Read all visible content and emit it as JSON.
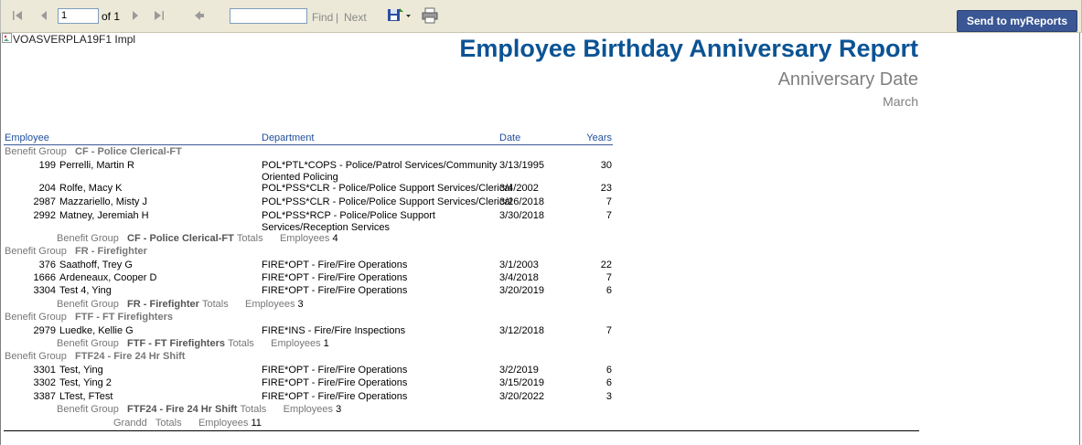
{
  "toolbar": {
    "page_value": "1",
    "of_label": "of 1",
    "find_label": "Find",
    "separator": "|",
    "next_label": "Next",
    "send_button": "Send to myReports"
  },
  "report": {
    "image_alt": "VOASVERPLA19F1 Impl",
    "title": "Employee Birthday Anniversary Report",
    "subtitle": "Anniversary Date",
    "month": "March",
    "columns": {
      "employee": "Employee",
      "department": "Department",
      "date": "Date",
      "years": "Years"
    },
    "group_label": "Benefit Group",
    "totals_label": "Totals",
    "employees_label": "Employees",
    "groups": [
      {
        "name": "CF - Police Clerical-FT",
        "rows": [
          {
            "id": "199",
            "name": "Perrelli, Martin R",
            "dept1": "POL*PTL*COPS - Police/Patrol Services/Community",
            "dept2": "Oriented Policing",
            "date": "3/13/1995",
            "years": "30"
          },
          {
            "id": "204",
            "name": "Rolfe, Macy K",
            "dept1": "POL*PSS*CLR - Police/Police Support Services/Clerical",
            "dept2": "",
            "date": "3/4/2002",
            "years": "23"
          },
          {
            "id": "2987",
            "name": "Mazzariello, Misty J",
            "dept1": "POL*PSS*CLR - Police/Police Support Services/Clerical",
            "dept2": "",
            "date": "3/26/2018",
            "years": "7"
          },
          {
            "id": "2992",
            "name": "Matney, Jeremiah H",
            "dept1": "POL*PSS*RCP - Police/Police Support",
            "dept2": "Services/Reception Services",
            "date": "3/30/2018",
            "years": "7"
          }
        ],
        "count": "4"
      },
      {
        "name": "FR - Firefighter",
        "rows": [
          {
            "id": "376",
            "name": "Saathoff, Trey G",
            "dept1": "FIRE*OPT - Fire/Fire Operations",
            "dept2": "",
            "date": "3/1/2003",
            "years": "22"
          },
          {
            "id": "1666",
            "name": "Ardeneaux, Cooper D",
            "dept1": "FIRE*OPT - Fire/Fire Operations",
            "dept2": "",
            "date": "3/4/2018",
            "years": "7"
          },
          {
            "id": "3304",
            "name": "Test 4, Ying",
            "dept1": "FIRE*OPT - Fire/Fire Operations",
            "dept2": "",
            "date": "3/20/2019",
            "years": "6"
          }
        ],
        "count": "3"
      },
      {
        "name": "FTF - FT Firefighters",
        "rows": [
          {
            "id": "2979",
            "name": "Luedke, Kellie G",
            "dept1": "FIRE*INS - Fire/Fire Inspections",
            "dept2": "",
            "date": "3/12/2018",
            "years": "7"
          }
        ],
        "count": "1"
      },
      {
        "name": "FTF24 - Fire 24 Hr Shift",
        "rows": [
          {
            "id": "3301",
            "name": "Test, Ying",
            "dept1": "FIRE*OPT - Fire/Fire Operations",
            "dept2": "",
            "date": "3/2/2019",
            "years": "6"
          },
          {
            "id": "3302",
            "name": "Test, Ying 2",
            "dept1": "FIRE*OPT - Fire/Fire Operations",
            "dept2": "",
            "date": "3/15/2019",
            "years": "6"
          },
          {
            "id": "3387",
            "name": "LTest, FTest",
            "dept1": "FIRE*OPT - Fire/Fire Operations",
            "dept2": "",
            "date": "3/20/2022",
            "years": "3"
          }
        ],
        "count": "3"
      }
    ],
    "grand": {
      "label": "Grandd",
      "totals": "Totals",
      "employees": "Employees",
      "count": "11"
    }
  }
}
